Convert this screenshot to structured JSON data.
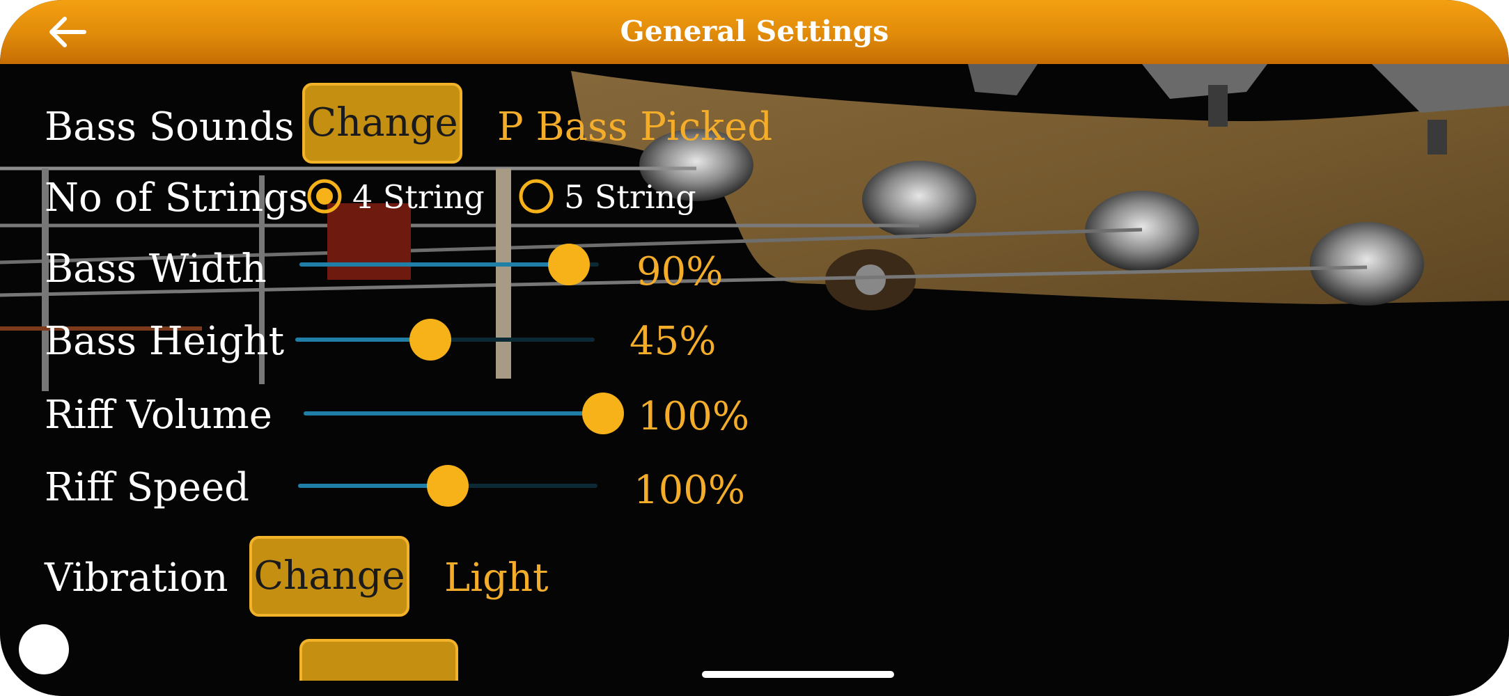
{
  "header": {
    "title": "General Settings"
  },
  "colors": {
    "accent": "#f4ad2a",
    "header_top": "#f4a012",
    "header_bottom": "#c66d04",
    "button_fill": "#c58f12",
    "slider_track": "#1f7fa6"
  },
  "settings": {
    "bass_sounds": {
      "label": "Bass Sounds",
      "button": "Change",
      "value": "P Bass Picked"
    },
    "strings": {
      "label": "No of Strings",
      "options": [
        {
          "label": "4 String",
          "selected": true
        },
        {
          "label": "5 String",
          "selected": false
        }
      ]
    },
    "bass_width": {
      "label": "Bass Width",
      "value": "90%",
      "level": 0.9
    },
    "bass_height": {
      "label": "Bass Height",
      "value": "45%",
      "level": 0.45
    },
    "riff_volume": {
      "label": "Riff Volume",
      "value": "100%",
      "level": 1.0
    },
    "riff_speed": {
      "label": "Riff Speed",
      "value": "100%",
      "level": 0.5
    },
    "vibration": {
      "label": "Vibration",
      "button": "Change",
      "value": "Light"
    }
  },
  "icons": {
    "back": "arrow-left-icon",
    "assistive": "assistive-touch-icon"
  }
}
